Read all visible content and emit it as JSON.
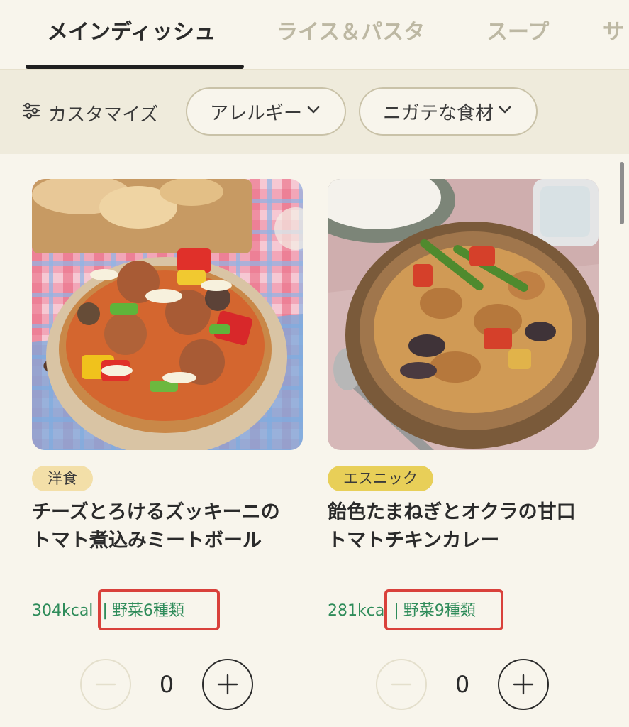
{
  "tabs": [
    {
      "label": "メインディッシュ",
      "active": true
    },
    {
      "label": "ライス＆パスタ",
      "active": false
    },
    {
      "label": "スープ",
      "active": false
    },
    {
      "label": "サ",
      "active": false
    }
  ],
  "filters": {
    "customize_label": "カスタマイズ",
    "customize_icon": "sliders-icon",
    "pills": [
      {
        "label": "アレルギー",
        "icon": "chevron-down-icon"
      },
      {
        "label": "ニガテな食材",
        "icon": "chevron-down-icon"
      }
    ]
  },
  "cards": [
    {
      "tag": "洋食",
      "tag_color": "#f3dfa8",
      "title": "チーズとろけるズッキーニのトマト煮込みミートボール",
      "kcal": "304kcal",
      "separator": "|",
      "vegetables": "野菜6種類",
      "quantity": "0"
    },
    {
      "tag": "エスニック",
      "tag_color": "#e8cf58",
      "title": "飴色たまねぎとオクラの甘口トマトチキンカレー",
      "kcal": "281kca",
      "separator": "|",
      "vegetables": "野菜9種類",
      "quantity": "0"
    }
  ],
  "colors": {
    "background": "#f8f5ec",
    "filter_bar": "#efebdc",
    "meta_green": "#2f8c5a",
    "highlight_red": "#d9413b"
  }
}
